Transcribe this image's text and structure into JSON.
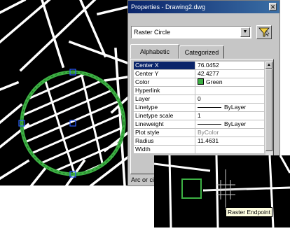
{
  "palette": {
    "title": "Properties - Drawing2.dwg",
    "close_glyph": "✕",
    "object_type": "Raster Circle",
    "dropdown_glyph": "▼",
    "tabs": [
      {
        "label": "Alphabetic",
        "active": true
      },
      {
        "label": "Categorized",
        "active": false
      }
    ],
    "properties": [
      {
        "name": "Center X",
        "value": "76.0452",
        "selected": true
      },
      {
        "name": "Center Y",
        "value": "42.4277"
      },
      {
        "name": "Color",
        "value": "Green",
        "swatch": "#3cb043"
      },
      {
        "name": "Hyperlink",
        "value": ""
      },
      {
        "name": "Layer",
        "value": "0"
      },
      {
        "name": "Linetype",
        "value": "ByLayer",
        "line_sample": true
      },
      {
        "name": "Linetype scale",
        "value": "1"
      },
      {
        "name": "Lineweight",
        "value": "ByLayer",
        "line_sample": true
      },
      {
        "name": "Plot style",
        "value": "ByColor",
        "disabled": true
      },
      {
        "name": "Radius",
        "value": "11.4631"
      },
      {
        "name": "Width",
        "value": ""
      }
    ],
    "description": "Arc or cir",
    "scroll_up_glyph": "▲",
    "scroll_down_glyph": "▼"
  },
  "inset": {
    "tooltip": "Raster Endpoint"
  },
  "colors": {
    "selection_green": "#3cb043",
    "grip_blue": "#2b5cff",
    "titlebar": "#0a246a"
  },
  "icons": [
    "quick-select-icon",
    "close-icon",
    "chevron-down-icon"
  ]
}
